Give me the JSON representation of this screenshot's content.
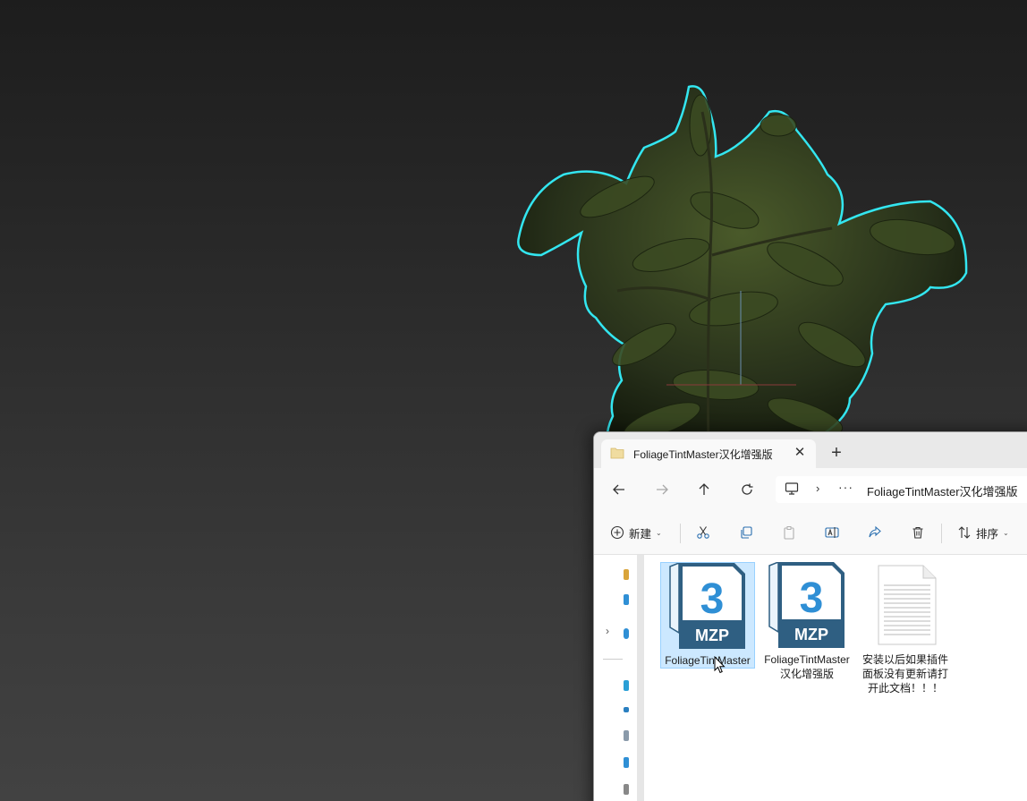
{
  "explorer": {
    "tab": {
      "title": "FoliageTintMaster汉化增强版",
      "close_glyph": "✕",
      "new_tab_glyph": "+"
    },
    "navigation": {
      "back_icon": "arrow-left-icon",
      "forward_icon": "arrow-right-icon",
      "up_icon": "arrow-up-icon",
      "refresh_icon": "refresh-icon"
    },
    "address": {
      "separator": "›",
      "more": "···",
      "path_crumb": "FoliageTintMaster汉化增强版"
    },
    "commands": {
      "new_label": "新建",
      "sort_label": "排序",
      "caret": "⌄"
    },
    "files": [
      {
        "name": "FoliageTintMaster",
        "type": "mzp",
        "badge_number": "3",
        "badge_text": "MZP",
        "selected": true
      },
      {
        "name": "FoliageTintMaster汉化增强版",
        "type": "mzp",
        "badge_number": "3",
        "badge_text": "MZP",
        "selected": false
      },
      {
        "name": "安装以后如果插件面板没有更新请打开此文档！！！",
        "type": "txt",
        "selected": false
      }
    ],
    "navpane": {
      "expand_glyph": "›"
    },
    "colors": {
      "mzp_blue": "#2f8fd5",
      "mzp_dark": "#2f5f82",
      "selection": "#cce8ff",
      "outline_cyan": "#33e6f0"
    }
  }
}
